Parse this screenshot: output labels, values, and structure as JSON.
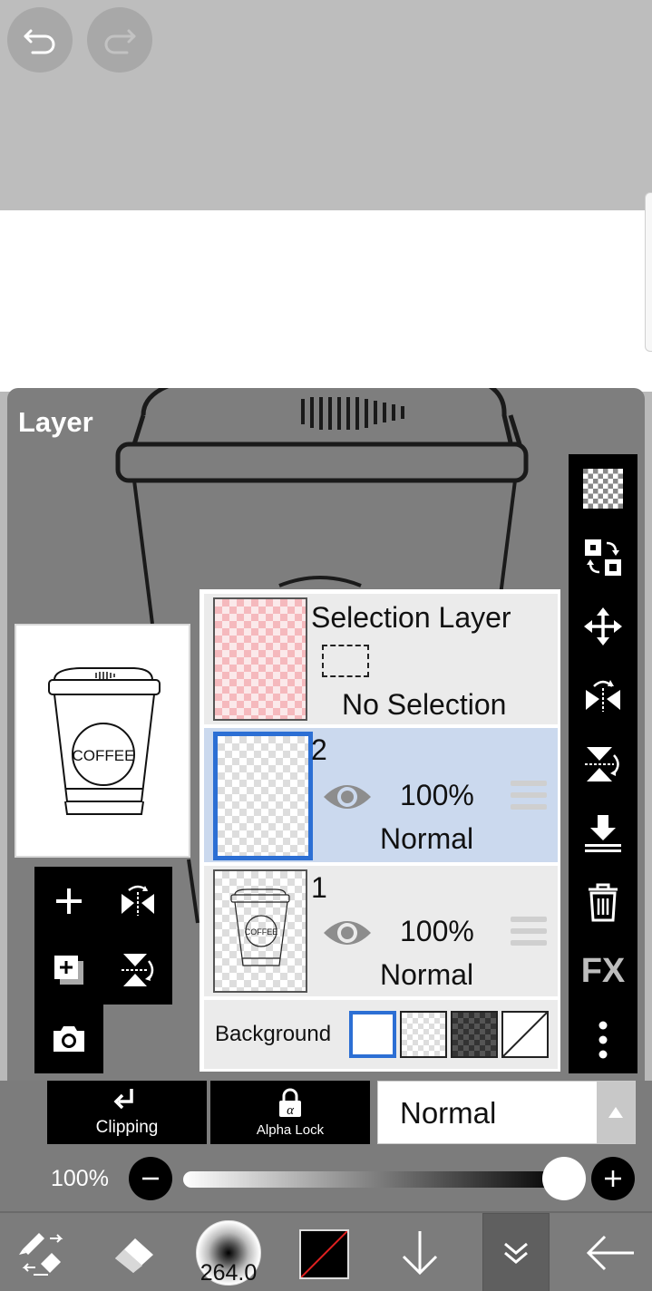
{
  "panel": {
    "title": "Layer"
  },
  "thumbnail": {
    "cup_text": "COFFEE"
  },
  "layers": {
    "selection_layer": {
      "name": "Selection Layer",
      "status": "No Selection"
    },
    "items": [
      {
        "number": "2",
        "opacity": "100%",
        "blend": "Normal",
        "selected": true
      },
      {
        "number": "1",
        "opacity": "100%",
        "blend": "Normal",
        "selected": false,
        "thumb_text": "COFFEE"
      }
    ],
    "background": {
      "label": "Background",
      "options": [
        "white",
        "checker",
        "dark-checker",
        "none"
      ],
      "selected": "white"
    }
  },
  "right_tools": [
    "transparent-fill-icon",
    "swap-layer-icon",
    "move-icon",
    "flip-horizontal-icon",
    "flip-vertical-icon",
    "merge-down-icon",
    "trash-icon",
    "fx-icon",
    "more-icon"
  ],
  "right_tools_labels": {
    "fx": "FX"
  },
  "bottom": {
    "clipping_label": "Clipping",
    "alpha_lock_label": "Alpha Lock",
    "blend_mode": "Normal",
    "opacity_label": "100%",
    "opacity_value": 100
  },
  "toolbar": {
    "brush_size": "264.0",
    "color_hex": "#000000"
  },
  "colors": {
    "selected_border": "#2c6fd4",
    "selected_row": "#cbd9ee"
  }
}
